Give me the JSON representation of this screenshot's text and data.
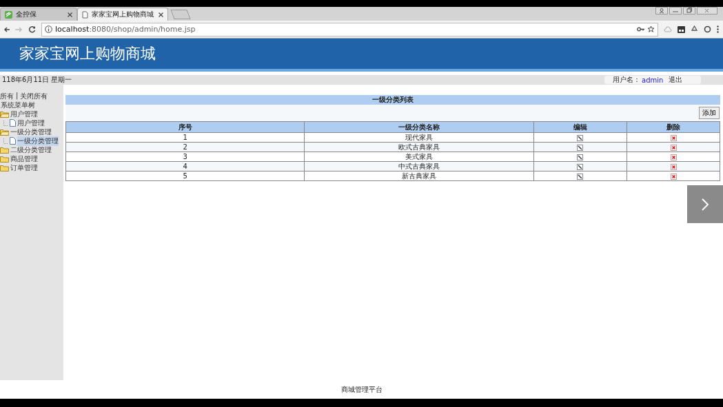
{
  "browser": {
    "tabs": [
      {
        "title": "全控保",
        "selected": false
      },
      {
        "title": "家家宝网上购物商城",
        "selected": true
      }
    ],
    "url_host": "localhost",
    "url_rest": ":8080/shop/admin/home.jsp"
  },
  "header": {
    "title": "家家宝网上购物商城"
  },
  "info_bar": {
    "date": "118年6月11日 星期一",
    "user_label": "用户名：",
    "user_name": "admin",
    "logout": "退出"
  },
  "sidebar": {
    "expand_all": "所有",
    "separator": "|",
    "collapse_all": "关闭所有",
    "tree_title": "系统菜单树",
    "items": [
      {
        "label": "用户管理",
        "expanded": true,
        "children": [
          {
            "label": "用户管理",
            "selected": false
          }
        ]
      },
      {
        "label": "一级分类管理",
        "expanded": true,
        "children": [
          {
            "label": "一级分类管理",
            "selected": true
          }
        ]
      },
      {
        "label": "二级分类管理",
        "expanded": false
      },
      {
        "label": "商品管理",
        "expanded": false
      },
      {
        "label": "订单管理",
        "expanded": false
      }
    ]
  },
  "table": {
    "title": "一级分类列表",
    "add_button": "添加",
    "columns": [
      "序号",
      "一级分类名称",
      "编辑",
      "删除"
    ],
    "rows": [
      {
        "index": "1",
        "name": "现代家具"
      },
      {
        "index": "2",
        "name": "欧式古典家具"
      },
      {
        "index": "3",
        "name": "美式家具"
      },
      {
        "index": "4",
        "name": "中式古典家具"
      },
      {
        "index": "5",
        "name": "新古典家具"
      }
    ]
  },
  "footer": "商城管理平台"
}
